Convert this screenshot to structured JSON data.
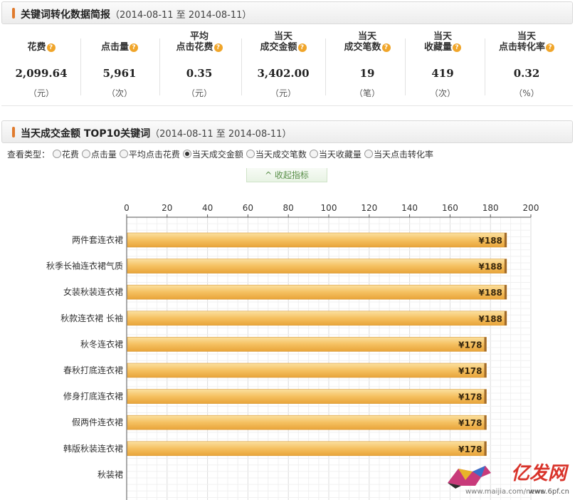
{
  "summary": {
    "title": "关键词转化数据简报",
    "range": "（2014-08-11 至 2014-08-11）",
    "stats": [
      {
        "label1": "",
        "label2": "花费",
        "value": "2,099.64",
        "unit": "（元）"
      },
      {
        "label1": "",
        "label2": "点击量",
        "value": "5,961",
        "unit": "（次）"
      },
      {
        "label1": "平均",
        "label2": "点击花费",
        "value": "0.35",
        "unit": "（元）"
      },
      {
        "label1": "当天",
        "label2": "成交金额",
        "value": "3,402.00",
        "unit": "（元）"
      },
      {
        "label1": "当天",
        "label2": "成交笔数",
        "value": "19",
        "unit": "（笔）"
      },
      {
        "label1": "当天",
        "label2": "收藏量",
        "value": "419",
        "unit": "（次）"
      },
      {
        "label1": "当天",
        "label2": "点击转化率",
        "value": "0.32",
        "unit": "（%）"
      }
    ],
    "help_glyph": "?"
  },
  "top10": {
    "title": "当天成交金额 TOP10关键词",
    "range": "（2014-08-11 至 2014-08-11）",
    "filter_label": "查看类型：",
    "filter_options": [
      {
        "label": "花费",
        "selected": false
      },
      {
        "label": "点击量",
        "selected": false
      },
      {
        "label": "平均点击花费",
        "selected": false
      },
      {
        "label": "当天成交金额",
        "selected": true
      },
      {
        "label": "当天成交笔数",
        "selected": false
      },
      {
        "label": "当天收藏量",
        "selected": false
      },
      {
        "label": "当天点击转化率",
        "selected": false
      }
    ],
    "collapse_label": "^ 收起指标"
  },
  "chart_data": {
    "type": "bar",
    "orientation": "horizontal",
    "categories": [
      "两件套连衣裙",
      "秋季长袖连衣裙气质",
      "女装秋装连衣裙",
      "秋款连衣裙 长袖",
      "秋冬连衣裙",
      "春秋打底连衣裙",
      "修身打底连衣裙",
      "假两件连衣裙",
      "韩版秋装连衣裙",
      "秋装裙"
    ],
    "values": [
      188,
      188,
      188,
      188,
      178,
      178,
      178,
      178,
      178,
      null
    ],
    "value_labels": [
      "¥188",
      "¥188",
      "¥188",
      "¥188",
      "¥178",
      "¥178",
      "¥178",
      "¥178",
      "¥178",
      ""
    ],
    "xlim": [
      0,
      200
    ],
    "ticks": [
      0,
      20,
      40,
      60,
      80,
      100,
      120,
      140,
      160,
      180,
      200
    ],
    "grid": true,
    "bar_color": "#f5c060"
  },
  "watermark": {
    "brand": "亿发网",
    "url": "www.6pf.cn",
    "url2": "www.maijia.com/news"
  },
  "colors": {
    "accent": "#e07a2c",
    "bar": "#f5c060",
    "help": "#f0a52a"
  }
}
